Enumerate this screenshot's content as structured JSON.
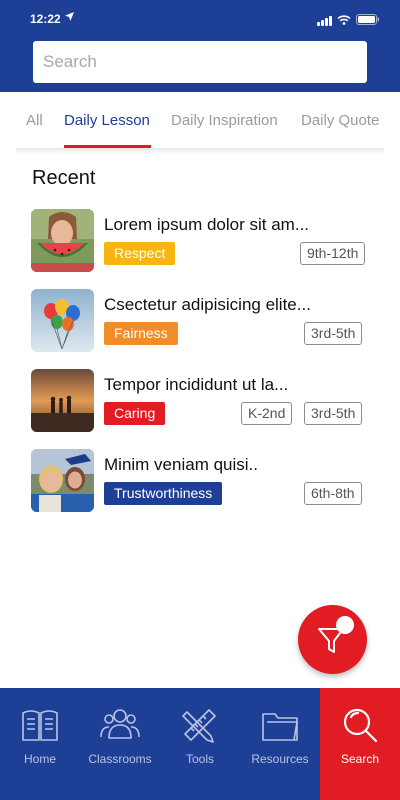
{
  "status_bar": {
    "time": "12:22",
    "location_icon": "location-arrow-icon"
  },
  "search": {
    "placeholder": "Search",
    "value": ""
  },
  "tabs": [
    {
      "label": "All",
      "active": false
    },
    {
      "label": "Daily Lesson",
      "active": true
    },
    {
      "label": "Daily  Inspiration",
      "active": false
    },
    {
      "label": "Daily Quote",
      "active": false
    }
  ],
  "section": {
    "title": "Recent"
  },
  "items": [
    {
      "title": "Lorem ipsum dolor sit am...",
      "tag": "Respect",
      "tag_color": "#f7b512",
      "grades": [
        "9th-12th"
      ],
      "thumb": "girl-with-watermelon"
    },
    {
      "title": "Csectetur adipisicing elite...",
      "tag": "Fairness",
      "tag_color": "#f28c28",
      "grades": [
        "3rd-5th"
      ],
      "thumb": "balloons"
    },
    {
      "title": "Tempor incididunt ut la...",
      "tag": "Caring",
      "tag_color": "#e11c22",
      "grades": [
        "K-2nd",
        "3rd-5th"
      ],
      "thumb": "sunset-silhouettes"
    },
    {
      "title": "Minim veniam quisi..",
      "tag": "Trustworthiness",
      "tag_color": "#1e3f96",
      "grades": [
        "6th-8th"
      ],
      "thumb": "graduates-hugging"
    }
  ],
  "fab": {
    "icon": "filter-icon"
  },
  "nav": [
    {
      "label": "Home",
      "icon": "book-icon",
      "active": false
    },
    {
      "label": "Classrooms",
      "icon": "users-icon",
      "active": false
    },
    {
      "label": "Tools",
      "icon": "pencil-ruler-icon",
      "active": false
    },
    {
      "label": "Resources",
      "icon": "folder-icon",
      "active": false
    },
    {
      "label": "Search",
      "icon": "search-icon",
      "active": true
    }
  ],
  "colors": {
    "brand_blue": "#1e3f96",
    "accent_red": "#e11c22"
  }
}
